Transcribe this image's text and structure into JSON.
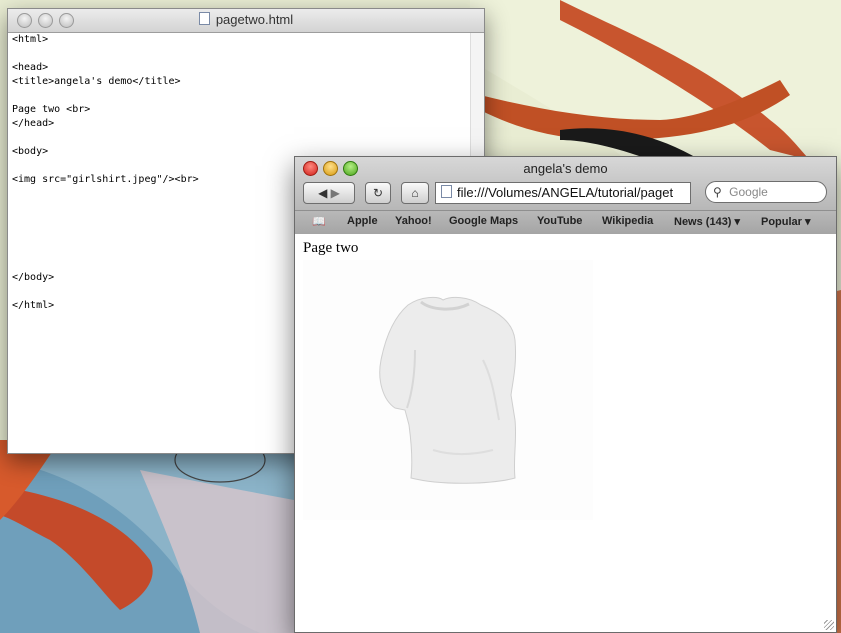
{
  "editor": {
    "title": "pagetwo.html",
    "lines": [
      "<html>",
      "",
      "<head>",
      "<title>angela's demo</title>",
      "",
      "Page two <br>",
      "</head>",
      "",
      "<body>",
      "",
      "<img src=\"girlshirt.jpeg\"/><br>",
      "",
      "",
      "",
      "",
      "",
      "",
      "</body>",
      "",
      "</html>"
    ]
  },
  "browser": {
    "title": "angela's demo",
    "address": "file:///Volumes/ANGELA/tutorial/paget",
    "search_placeholder": "Google",
    "bookmarks": [
      "Apple",
      "Yahoo!",
      "Google Maps",
      "YouTube",
      "Wikipedia",
      "News (143)",
      "Popular"
    ],
    "page": {
      "text": "Page two"
    }
  }
}
